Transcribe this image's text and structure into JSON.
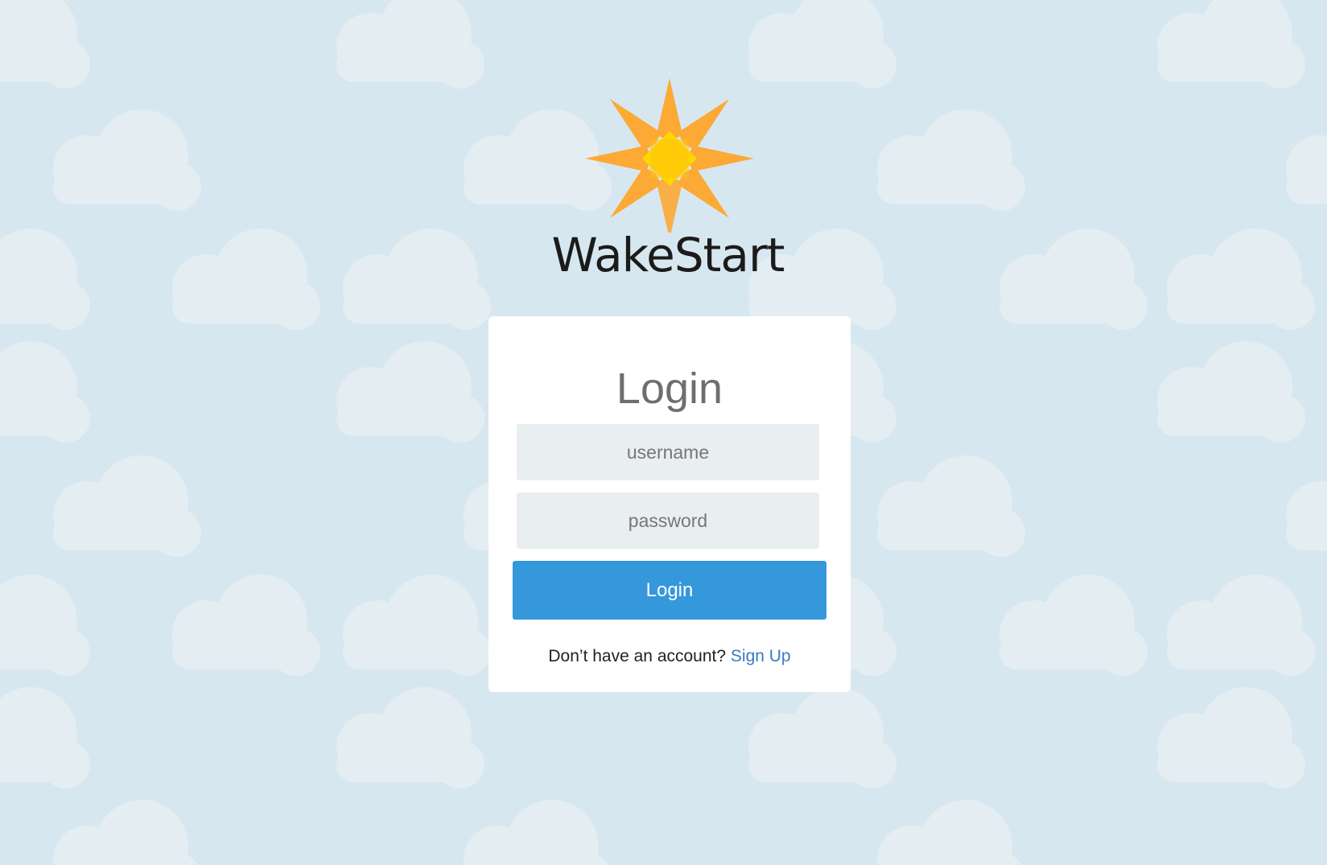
{
  "brand": {
    "name": "WakeStart"
  },
  "login": {
    "title": "Login",
    "username_placeholder": "username",
    "password_placeholder": "password",
    "submit_label": "Login",
    "signup_prompt": "Don’t have an account?",
    "signup_link": "Sign Up"
  },
  "colors": {
    "background": "#d7e7f0",
    "cloud": "#e4edf2",
    "card": "#ffffff",
    "input_bg": "#e9eef0",
    "button": "#3598db",
    "link": "#3a7bbf",
    "sun_petal": "#ffa62b",
    "sun_center": "#ffd600"
  },
  "icons": {
    "logo": "sun-star-icon",
    "background": "cloud-pattern"
  }
}
